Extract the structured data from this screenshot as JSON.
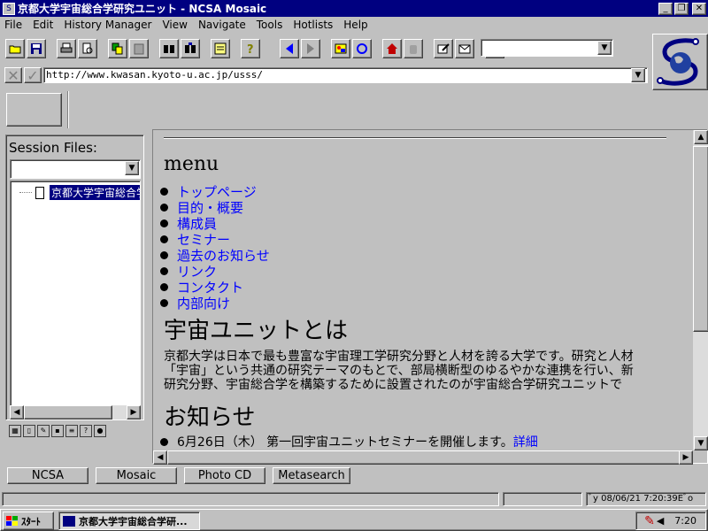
{
  "window": {
    "title": "京都大学宇宙総合学研究ユニット - NCSA Mosaic",
    "minimize": "_",
    "restore": "❐",
    "close": "✕"
  },
  "menubar": {
    "items": [
      "File",
      "Edit",
      "History Manager",
      "View",
      "Navigate",
      "Tools",
      "Hotlists",
      "Help"
    ]
  },
  "address": {
    "url": "http://www.kwasan.kyoto-u.ac.jp/usss/"
  },
  "session": {
    "label": "Session Files:",
    "selected": "",
    "tree_item": "京都大学宇宙総合学研究ユニット"
  },
  "content": {
    "menu_heading": "menu",
    "menu_items": [
      "トップページ",
      "目的・概要",
      "構成員",
      "セミナー",
      "過去のお知らせ",
      "リンク",
      "コンタクト",
      "内部向け"
    ],
    "about_heading": "宇宙ユニットとは",
    "about_lines": [
      "京都大学は日本で最も豊富な宇宙理工学研究分野と人材を誇る大学です。研究と人材",
      "「宇宙」という共通の研究テーマのもとで、部局横断型のゆるやかな連携を行い、新",
      "研究分野、宇宙総合学を構築するために設置されたのが宇宙総合学研究ユニットで"
    ],
    "news_heading": "お知らせ",
    "news_item_text": "6月26日（木） 第一回宇宙ユニットセミナーを開催します。",
    "news_item_link": "詳細"
  },
  "bottom_buttons": [
    "NCSA",
    "Mosaic",
    "Photo CD",
    "Metasearch"
  ],
  "status": {
    "clock_text": "ﾞy 08/06/21 7:20:39Eﾞo"
  },
  "taskbar": {
    "start_label": "ｽﾀｰﾄ",
    "task_label": "京都大学宇宙総合学研...",
    "tray_time": "7:20"
  },
  "colors": {
    "titlebar": "#000080",
    "link": "#0000ff",
    "face": "#c0c0c0"
  }
}
